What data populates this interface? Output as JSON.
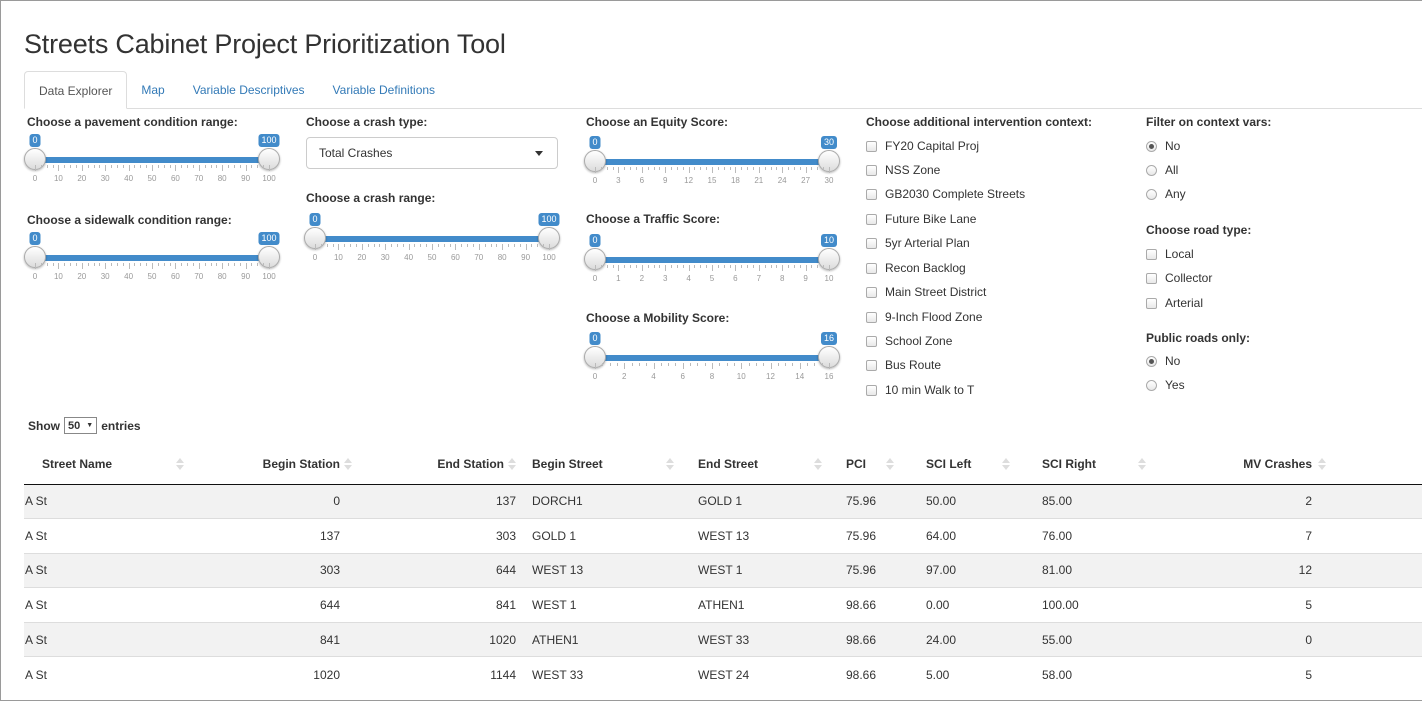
{
  "app": {
    "title": "Streets Cabinet Project Prioritization Tool"
  },
  "tabs": [
    "Data Explorer",
    "Map",
    "Variable Descriptives",
    "Variable Definitions"
  ],
  "filters": {
    "pavement": {
      "label": "Choose a pavement condition range:",
      "min": 0,
      "max": 100,
      "low": 0,
      "high": 100,
      "low_label": "0",
      "high_label": "100",
      "ticks": [
        "0",
        "10",
        "20",
        "30",
        "40",
        "50",
        "60",
        "70",
        "80",
        "90",
        "100"
      ]
    },
    "sidewalk": {
      "label": "Choose a sidewalk condition range:",
      "min": 0,
      "max": 100,
      "low": 0,
      "high": 100,
      "low_label": "0",
      "high_label": "100",
      "ticks": [
        "0",
        "10",
        "20",
        "30",
        "40",
        "50",
        "60",
        "70",
        "80",
        "90",
        "100"
      ]
    },
    "crash_type": {
      "label": "Choose a crash type:",
      "value": "Total Crashes"
    },
    "crash_range": {
      "label": "Choose a crash range:",
      "min": 0,
      "max": 100,
      "low": 0,
      "high": 100,
      "low_label": "0",
      "high_label": "100",
      "ticks": [
        "0",
        "10",
        "20",
        "30",
        "40",
        "50",
        "60",
        "70",
        "80",
        "90",
        "100"
      ]
    },
    "equity": {
      "label": "Choose an Equity Score:",
      "min": 0,
      "max": 30,
      "low": 0,
      "high": 30,
      "low_label": "0",
      "high_label": "30",
      "ticks": [
        "0",
        "3",
        "6",
        "9",
        "12",
        "15",
        "18",
        "21",
        "24",
        "27",
        "30"
      ]
    },
    "traffic": {
      "label": "Choose a Traffic Score:",
      "min": 0,
      "max": 10,
      "low": 0,
      "high": 10,
      "low_label": "0",
      "high_label": "10",
      "ticks": [
        "0",
        "1",
        "2",
        "3",
        "4",
        "5",
        "6",
        "7",
        "8",
        "9",
        "10"
      ]
    },
    "mobility": {
      "label": "Choose a Mobility Score:",
      "min": 0,
      "max": 16,
      "low": 0,
      "high": 16,
      "low_label": "0",
      "high_label": "16",
      "ticks": [
        "0",
        "2",
        "4",
        "6",
        "8",
        "10",
        "12",
        "14",
        "16"
      ]
    },
    "context": {
      "label": "Choose additional intervention context:",
      "options": [
        "FY20 Capital Proj",
        "NSS Zone",
        "GB2030 Complete Streets",
        "Future Bike Lane",
        "5yr Arterial Plan",
        "Recon Backlog",
        "Main Street District",
        "9-Inch Flood Zone",
        "School Zone",
        "Bus Route",
        "10 min Walk to T"
      ]
    },
    "filter_context": {
      "label": "Filter on context vars:",
      "options": [
        "No",
        "All",
        "Any"
      ],
      "selected": "No"
    },
    "road_type": {
      "label": "Choose road type:",
      "options": [
        "Local",
        "Collector",
        "Arterial"
      ]
    },
    "public_only": {
      "label": "Public roads only:",
      "options": [
        "No",
        "Yes"
      ],
      "selected": "No"
    }
  },
  "table": {
    "show_label": "Show",
    "entries_value": "50",
    "entries_label": "entries",
    "columns": [
      "Street Name",
      "Begin Station",
      "End Station",
      "Begin Street",
      "End Street",
      "PCI",
      "SCI Left",
      "SCI Right",
      "MV Crashes"
    ],
    "rows": [
      [
        "A St",
        "0",
        "137",
        "DORCH1",
        "GOLD 1",
        "75.96",
        "50.00",
        "85.00",
        "2"
      ],
      [
        "A St",
        "137",
        "303",
        "GOLD 1",
        "WEST 13",
        "75.96",
        "64.00",
        "76.00",
        "7"
      ],
      [
        "A St",
        "303",
        "644",
        "WEST 13",
        "WEST 1",
        "75.96",
        "97.00",
        "81.00",
        "12"
      ],
      [
        "A St",
        "644",
        "841",
        "WEST 1",
        "ATHEN1",
        "98.66",
        "0.00",
        "100.00",
        "5"
      ],
      [
        "A St",
        "841",
        "1020",
        "ATHEN1",
        "WEST 33",
        "98.66",
        "24.00",
        "55.00",
        "0"
      ],
      [
        "A St",
        "1020",
        "1144",
        "WEST 33",
        "WEST 24",
        "98.66",
        "5.00",
        "58.00",
        "5"
      ]
    ]
  },
  "colors": {
    "accent": "#428bca",
    "link": "#337ab7",
    "stripe": "#f2f2f2"
  }
}
